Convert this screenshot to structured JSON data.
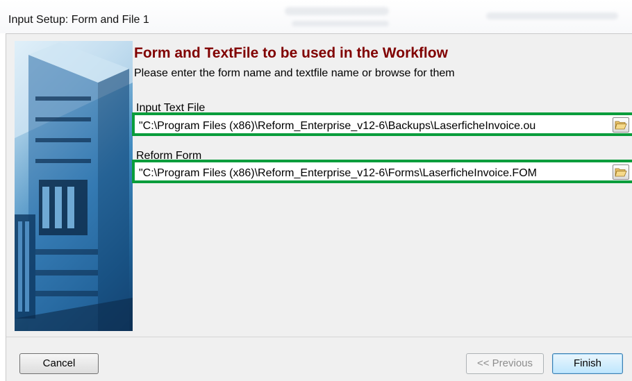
{
  "window": {
    "title": "Input Setup: Form and File 1"
  },
  "header": {
    "heading": "Form and TextFile to be used in the Workflow",
    "subheading": "Please enter the form name and textfile name or browse for them"
  },
  "fields": {
    "input_text_file": {
      "label": "Input Text File",
      "value": "\"C:\\Program Files (x86)\\Reform_Enterprise_v12-6\\Backups\\LaserficheInvoice.ou",
      "browse_icon": "folder-open-icon"
    },
    "reform_form": {
      "label": "Reform Form",
      "value": "\"C:\\Program Files (x86)\\Reform_Enterprise_v12-6\\Forms\\LaserficheInvoice.FOM",
      "browse_icon": "folder-open-icon"
    }
  },
  "buttons": {
    "cancel": "Cancel",
    "previous": "<< Previous",
    "finish": "Finish"
  },
  "colors": {
    "heading": "#800000",
    "highlight_border": "#0a9d3c",
    "dialog_background": "#f0f0f0",
    "finish_button_border": "#3c7fb1"
  }
}
